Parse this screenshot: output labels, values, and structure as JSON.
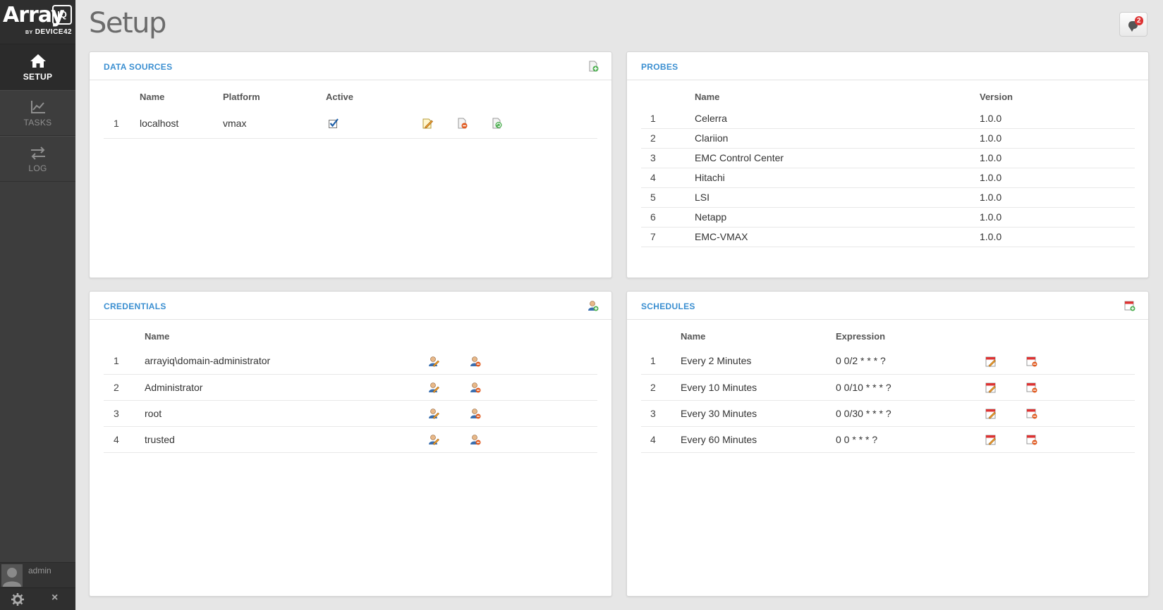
{
  "app": {
    "logo_text": "Array",
    "logo_badge": "IQ",
    "logo_by": "BY",
    "logo_vendor": "DEVICE42",
    "page_title": "Setup",
    "notification_count": "2"
  },
  "nav": [
    {
      "label": "SETUP",
      "icon": "home-icon",
      "active": true
    },
    {
      "label": "TASKS",
      "icon": "chart-icon",
      "active": false
    },
    {
      "label": "LOG",
      "icon": "arrows-icon",
      "active": false
    }
  ],
  "user": {
    "name": "admin"
  },
  "data_sources": {
    "title": "DATA SOURCES",
    "columns": [
      "Name",
      "Platform",
      "Active"
    ],
    "rows": [
      {
        "n": "1",
        "name": "localhost",
        "platform": "vmax",
        "active": true
      }
    ]
  },
  "probes": {
    "title": "PROBES",
    "columns": [
      "Name",
      "Version"
    ],
    "rows": [
      {
        "n": "1",
        "name": "Celerra",
        "version": "1.0.0"
      },
      {
        "n": "2",
        "name": "Clariion",
        "version": "1.0.0"
      },
      {
        "n": "3",
        "name": "EMC Control Center",
        "version": "1.0.0"
      },
      {
        "n": "4",
        "name": "Hitachi",
        "version": "1.0.0"
      },
      {
        "n": "5",
        "name": "LSI",
        "version": "1.0.0"
      },
      {
        "n": "6",
        "name": "Netapp",
        "version": "1.0.0"
      },
      {
        "n": "7",
        "name": "EMC-VMAX",
        "version": "1.0.0"
      }
    ]
  },
  "credentials": {
    "title": "CREDENTIALS",
    "columns": [
      "Name"
    ],
    "rows": [
      {
        "n": "1",
        "name": "arrayiq\\domain-administrator"
      },
      {
        "n": "2",
        "name": "Administrator"
      },
      {
        "n": "3",
        "name": "root"
      },
      {
        "n": "4",
        "name": "trusted"
      }
    ]
  },
  "schedules": {
    "title": "SCHEDULES",
    "columns": [
      "Name",
      "Expression"
    ],
    "rows": [
      {
        "n": "1",
        "name": "Every 2 Minutes",
        "expr": "0 0/2 * * * ?"
      },
      {
        "n": "2",
        "name": "Every 10 Minutes",
        "expr": "0 0/10 * * * ?"
      },
      {
        "n": "3",
        "name": "Every 30 Minutes",
        "expr": "0 0/30 * * * ?"
      },
      {
        "n": "4",
        "name": "Every 60 Minutes",
        "expr": "0 0 * * * ?"
      }
    ]
  },
  "colors": {
    "accent": "#3b8fd1",
    "sidebar": "#3d3d3d",
    "background": "#e6e6e6"
  }
}
